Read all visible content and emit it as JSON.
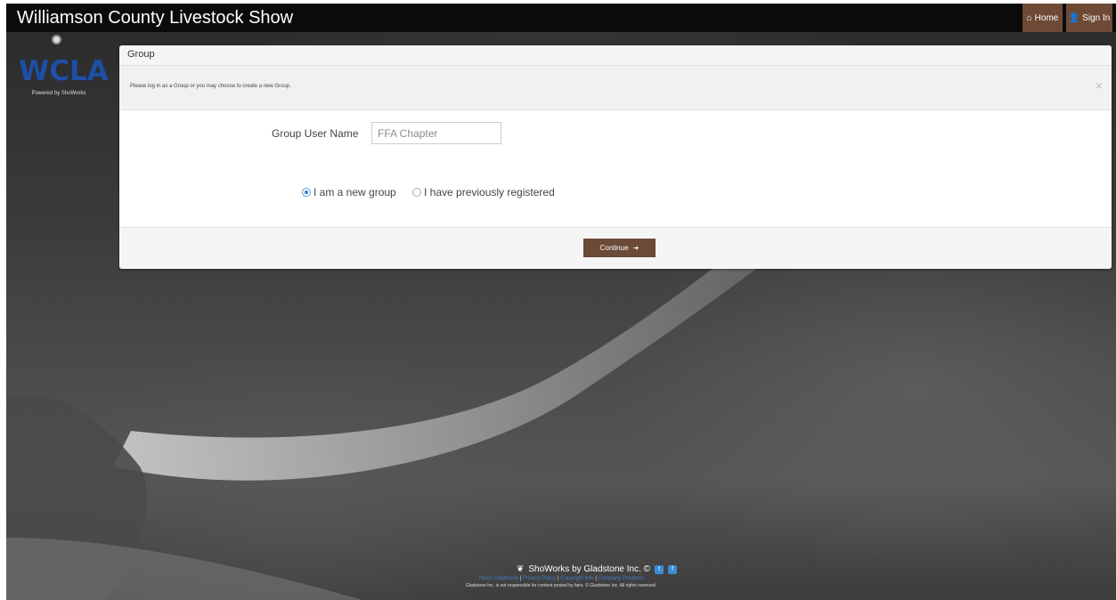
{
  "header": {
    "title": "Williamson County Livestock Show",
    "home_label": "Home",
    "signin_label": "Sign In"
  },
  "logo": {
    "mark": "WCLA",
    "powered": "Powered by ShoWorks"
  },
  "panel": {
    "title": "Group",
    "info_message": "Please log in as a Group or you may choose to create a new Group.",
    "close_glyph": "×",
    "field_label": "Group User Name",
    "field_placeholder": "FFA Chapter",
    "radio_new_label": "I am a new group",
    "radio_prev_label": "I have previously registered",
    "radio_selected": "new",
    "continue_label": "Continue"
  },
  "footer": {
    "brand": "ShoWorks by Gladstone Inc. ©",
    "links": [
      "About Gladstone",
      "Privacy Policy",
      "Copyright Info",
      "Company Products"
    ],
    "separator": "|",
    "legal": "Gladstone Inc. is not responsible for content posted by fairs. © Gladstone Inc. All rights reserved."
  },
  "icons": {
    "home": "home-icon",
    "user": "user-icon",
    "close": "close-icon",
    "arrow": "arrow-right-icon",
    "showorks": "showorks-logo-icon",
    "twitter": "twitter-icon",
    "facebook": "facebook-icon"
  },
  "colors": {
    "navbar": "#0b0b0b",
    "accent_brown": "#6e4a36",
    "logo_blue": "#1f4fa3",
    "link_blue": "#3f7ec2"
  }
}
